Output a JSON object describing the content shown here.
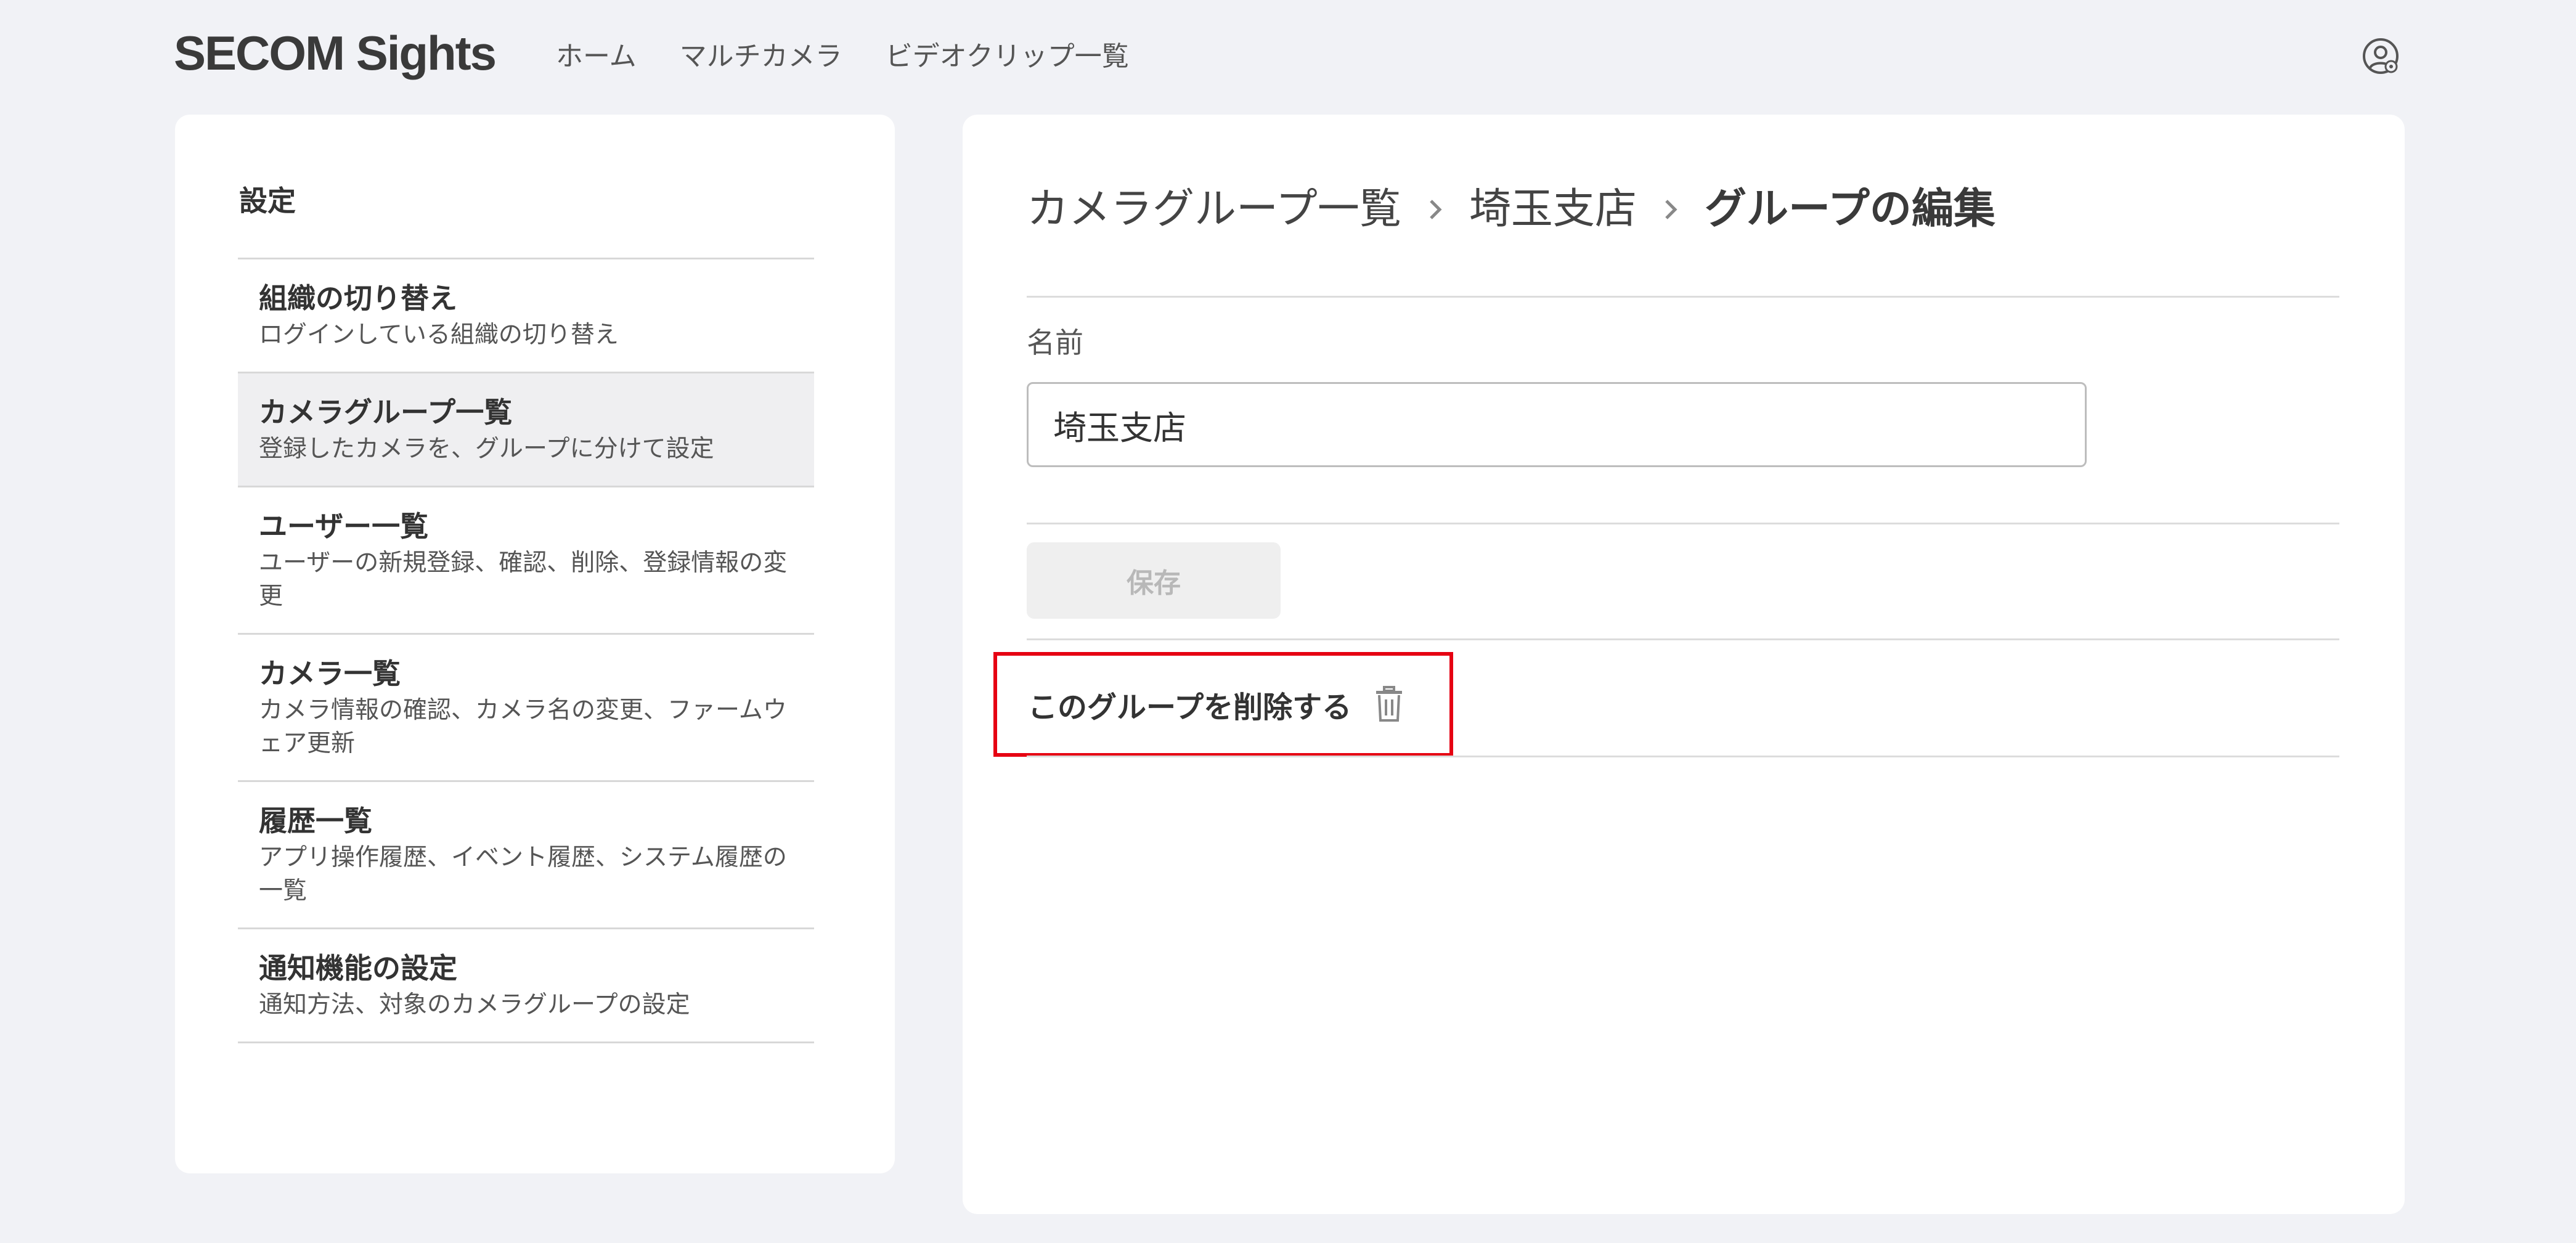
{
  "header": {
    "logo": "SECOM Sights",
    "nav": [
      {
        "label": "ホーム"
      },
      {
        "label": "マルチカメラ"
      },
      {
        "label": "ビデオクリップ一覧"
      }
    ],
    "account_icon": "user-settings-icon"
  },
  "sidebar": {
    "title": "設定",
    "items": [
      {
        "title": "組織の切り替え",
        "desc": "ログインしている組織の切り替え"
      },
      {
        "title": "カメラグループ一覧",
        "desc": "登録したカメラを、グループに分けて設定"
      },
      {
        "title": "ユーザー一覧",
        "desc": "ユーザーの新規登録、確認、削除、登録情報の変更"
      },
      {
        "title": "カメラ一覧",
        "desc": "カメラ情報の確認、カメラ名の変更、ファームウェア更新"
      },
      {
        "title": "履歴一覧",
        "desc": "アプリ操作履歴、イベント履歴、システム履歴の一覧"
      },
      {
        "title": "通知機能の設定",
        "desc": "通知方法、対象のカメラグループの設定"
      }
    ]
  },
  "main": {
    "breadcrumb": {
      "level1": "カメラグループ一覧",
      "level2": "埼玉支店",
      "current": "グループの編集"
    },
    "name_label": "名前",
    "name_value": "埼玉支店",
    "save_label": "保存",
    "delete_label": "このグループを削除する",
    "delete_icon": "trash-icon",
    "highlight_color": "#e60012"
  }
}
